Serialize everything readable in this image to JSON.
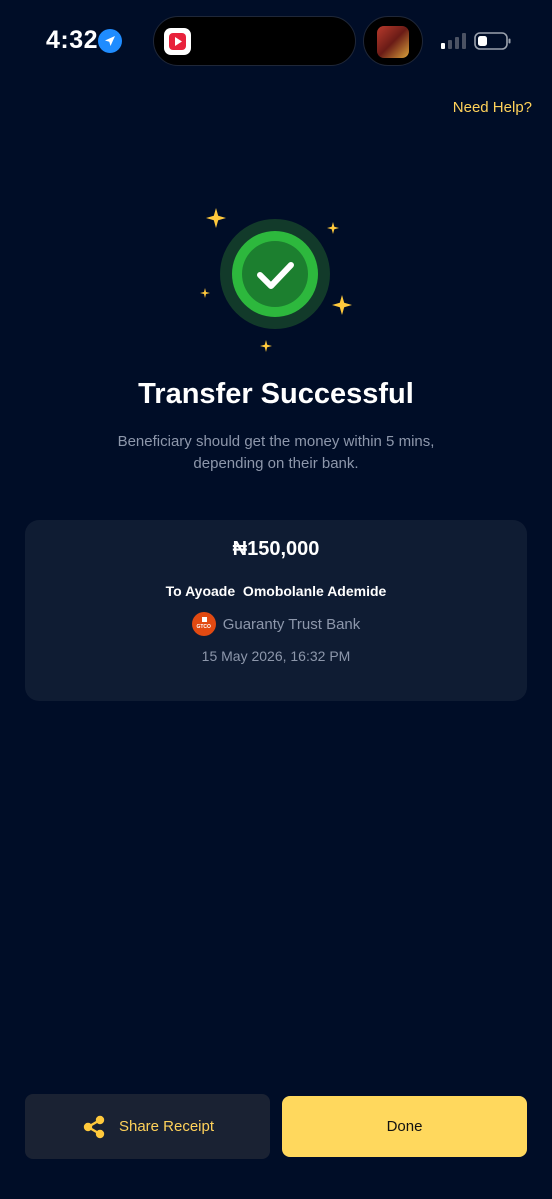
{
  "status_bar": {
    "time": "4:32",
    "location_icon": "location-arrow-icon",
    "app_icon": "video-play-icon",
    "signal_icon": "cellular-signal-icon",
    "battery_icon": "battery-icon"
  },
  "header": {
    "help_label": "Need Help?"
  },
  "success": {
    "icon": "checkmark-icon",
    "title": "Transfer Successful",
    "subtitle": "Beneficiary should get the money within 5 mins, depending on their bank."
  },
  "receipt": {
    "amount": "₦150,000",
    "recipient": "To Ayoade  Omobolanle Ademide",
    "bank_logo_text": "GTCO",
    "bank_name": "Guaranty Trust Bank",
    "date": "15 May 2026, 16:32 PM"
  },
  "actions": {
    "share_label": "Share Receipt",
    "share_icon": "share-icon",
    "done_label": "Done"
  },
  "colors": {
    "background": "#000d27",
    "card": "#0f1c33",
    "accent_yellow": "#ffd85d",
    "success_green": "#2db83d",
    "muted_text": "#8d97ab"
  }
}
